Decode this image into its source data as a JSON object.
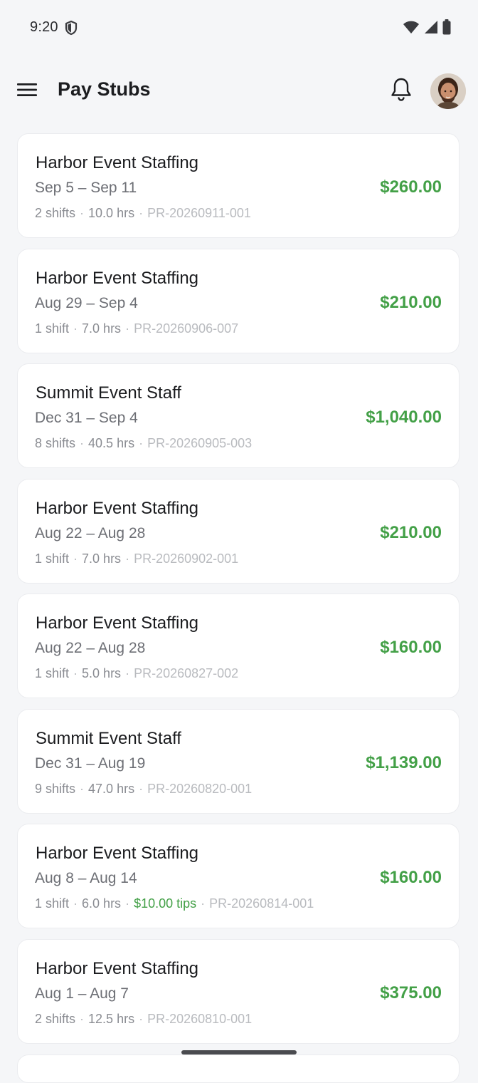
{
  "status_bar": {
    "time": "9:20",
    "icons": [
      "shield-icon",
      "wifi-icon",
      "cellular-signal-icon",
      "battery-icon"
    ]
  },
  "app_bar": {
    "title": "Pay Stubs",
    "menu_icon": "hamburger-menu-icon",
    "notification_icon": "bell-icon",
    "profile_icon": "avatar"
  },
  "colors": {
    "amount": "#43a047",
    "tips": "#43a047",
    "background": "#f5f6f8",
    "card": "#ffffff"
  },
  "pay_stubs": [
    {
      "employer": "Harbor Event Staffing",
      "period": "Sep 5 – Sep 11",
      "shifts": "2 shifts",
      "hours": "10.0 hrs",
      "tips": "",
      "reference": "PR-20260911-001",
      "amount": "$260.00"
    },
    {
      "employer": "Harbor Event Staffing",
      "period": "Aug 29 – Sep 4",
      "shifts": "1 shift",
      "hours": "7.0 hrs",
      "tips": "",
      "reference": "PR-20260906-007",
      "amount": "$210.00"
    },
    {
      "employer": "Summit Event Staff",
      "period": "Dec 31 – Sep 4",
      "shifts": "8 shifts",
      "hours": "40.5 hrs",
      "tips": "",
      "reference": "PR-20260905-003",
      "amount": "$1,040.00"
    },
    {
      "employer": "Harbor Event Staffing",
      "period": "Aug 22 – Aug 28",
      "shifts": "1 shift",
      "hours": "7.0 hrs",
      "tips": "",
      "reference": "PR-20260902-001",
      "amount": "$210.00"
    },
    {
      "employer": "Harbor Event Staffing",
      "period": "Aug 22 – Aug 28",
      "shifts": "1 shift",
      "hours": "5.0 hrs",
      "tips": "",
      "reference": "PR-20260827-002",
      "amount": "$160.00"
    },
    {
      "employer": "Summit Event Staff",
      "period": "Dec 31 – Aug 19",
      "shifts": "9 shifts",
      "hours": "47.0 hrs",
      "tips": "",
      "reference": "PR-20260820-001",
      "amount": "$1,139.00"
    },
    {
      "employer": "Harbor Event Staffing",
      "period": "Aug 8 – Aug 14",
      "shifts": "1 shift",
      "hours": "6.0 hrs",
      "tips": "$10.00 tips",
      "reference": "PR-20260814-001",
      "amount": "$160.00"
    },
    {
      "employer": "Harbor Event Staffing",
      "period": "Aug 1 – Aug 7",
      "shifts": "2 shifts",
      "hours": "12.5 hrs",
      "tips": "",
      "reference": "PR-20260810-001",
      "amount": "$375.00"
    }
  ]
}
